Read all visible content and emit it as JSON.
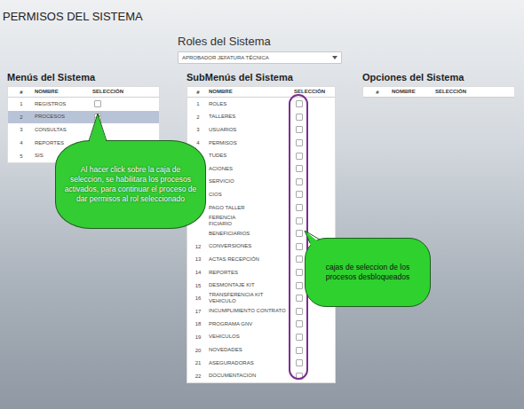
{
  "page": {
    "title": "PERMISOS DEL SISTEMA"
  },
  "roles": {
    "label": "Roles del Sistema",
    "selected_role": "APROBADOR JEFATURA TÉCNICA"
  },
  "panels": [
    {
      "title": "Menús del Sistema",
      "columns": [
        "#",
        "NOMBRE",
        "SELECCIÓN"
      ],
      "rows": [
        {
          "number": "1",
          "name": "REGISTROS",
          "checked": false,
          "selected": false
        },
        {
          "number": "2",
          "name": "PROCESOS",
          "checked": true,
          "selected": true
        },
        {
          "number": "3",
          "name": "CONSULTAS",
          "checked": false,
          "selected": false
        },
        {
          "number": "4",
          "name": "REPORTES",
          "checked": false,
          "selected": false
        },
        {
          "number": "5",
          "name": "SIS",
          "checked": false,
          "selected": false
        }
      ]
    },
    {
      "title": "SubMenús del Sistema",
      "columns": [
        "#",
        "NOMBRE",
        "SELECCIÓN"
      ],
      "rows": [
        {
          "number": "1",
          "name": "ROLES",
          "checked": false,
          "selected": false
        },
        {
          "number": "2",
          "name": "TALLERES",
          "checked": false,
          "selected": false
        },
        {
          "number": "3",
          "name": "USUARIOS",
          "checked": false,
          "selected": false
        },
        {
          "number": "4",
          "name": "PERMISOS",
          "checked": false,
          "selected": false
        },
        {
          "number": "",
          "name": "TUDES",
          "checked": false,
          "selected": false
        },
        {
          "number": "",
          "name": "ACIONES",
          "checked": false,
          "selected": false
        },
        {
          "number": "",
          "name": "SERVICIO",
          "checked": false,
          "selected": false
        },
        {
          "number": "",
          "name": "CIOS",
          "checked": false,
          "selected": false
        },
        {
          "number": "",
          "name": "PAGO TALLER",
          "checked": false,
          "selected": false
        },
        {
          "number": "",
          "name": "FERENCIA\nFICIARIO",
          "checked": false,
          "selected": false
        },
        {
          "number": "",
          "name": "BENEFICIARIOS",
          "checked": false,
          "selected": false
        },
        {
          "number": "12",
          "name": "CONVERSIONES",
          "checked": false,
          "selected": false
        },
        {
          "number": "13",
          "name": "ACTAS RECEPCIÓN",
          "checked": false,
          "selected": false
        },
        {
          "number": "14",
          "name": "REPORTES",
          "checked": false,
          "selected": false
        },
        {
          "number": "15",
          "name": "DESMONTAJE KIT",
          "checked": false,
          "selected": false
        },
        {
          "number": "16",
          "name": "TRANSFERENCIA KIT\nVEHICULO",
          "checked": false,
          "selected": false
        },
        {
          "number": "17",
          "name": "INCUMPLIMIENTO CONTRATO",
          "checked": false,
          "selected": false
        },
        {
          "number": "18",
          "name": "PROGRAMA GNV",
          "checked": false,
          "selected": false
        },
        {
          "number": "19",
          "name": "VEHICULOS",
          "checked": false,
          "selected": false
        },
        {
          "number": "20",
          "name": "NOVEDADES",
          "checked": false,
          "selected": false
        },
        {
          "number": "21",
          "name": "ASEGURADORAS",
          "checked": false,
          "selected": false
        },
        {
          "number": "22",
          "name": "DOCUMENTACION",
          "checked": false,
          "selected": false
        }
      ]
    },
    {
      "title": "Opciones del Sistema",
      "columns": [
        "#",
        "NOMBRE",
        "SELECCIÓN"
      ],
      "rows": []
    }
  ],
  "callouts": [
    {
      "text": "Al hacer click sobre la caja de seleccion, se habilitara los procesos activados, para continuar el proceso de dar permisos al rol seleccionado"
    },
    {
      "text": "cajas de seleccion de los procesos desbloqueados"
    }
  ]
}
